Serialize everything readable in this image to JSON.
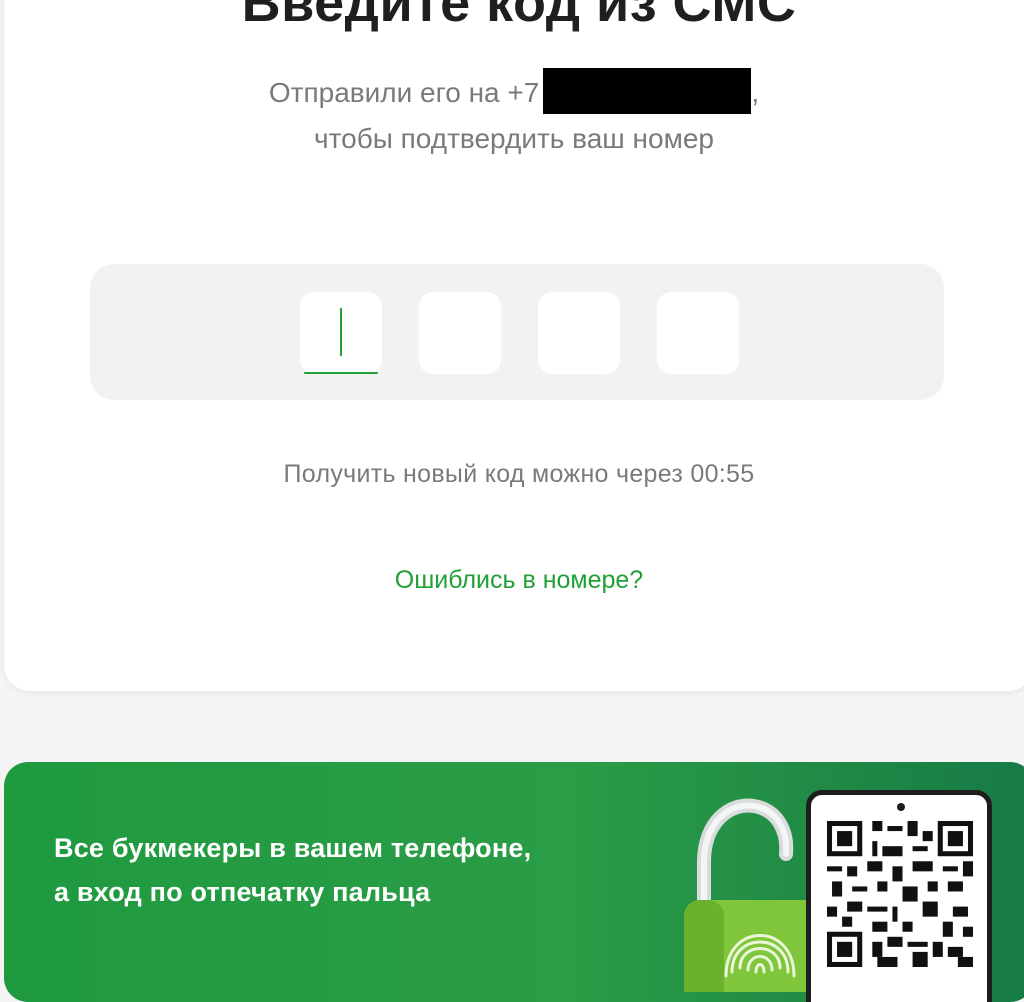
{
  "verify": {
    "title": "Введите код из СМС",
    "subtitle_prefix": "Отправили его на +7",
    "subtitle_suffix": ",",
    "subtitle_line2": "чтобы подтвердить ваш номер",
    "code_digits": [
      "",
      "",
      "",
      ""
    ],
    "timer_text": "Получить новый код можно через 00:55",
    "mistake_link": "Ошиблись в номере?"
  },
  "banner": {
    "line1": "Все букмекеры в вашем телефоне,",
    "line2": "а вход по отпечатку пальца",
    "icons": [
      "open-padlock-icon",
      "fingerprint-icon",
      "phone-qr-icon"
    ]
  },
  "colors": {
    "accent": "#21a038",
    "banner_bg": "#1f9a3f",
    "title": "#1f1f1f",
    "muted": "#7a7a7a"
  }
}
